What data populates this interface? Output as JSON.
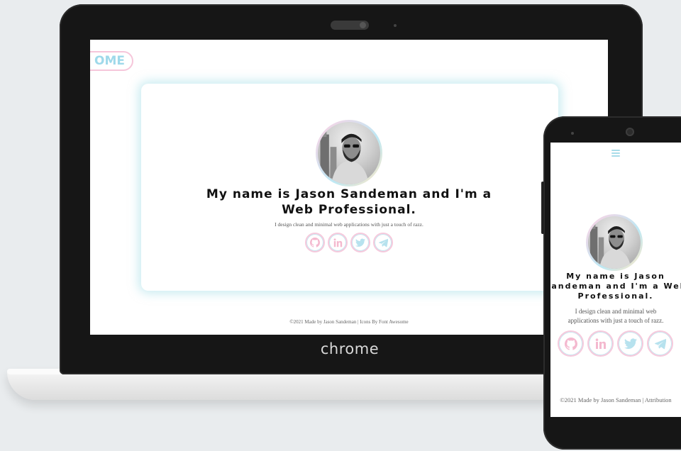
{
  "laptop": {
    "brand": "chrome",
    "site": {
      "logo_text": "OME",
      "headline": "My name is Jason Sandeman and I'm a Web Professional.",
      "tagline": "I design clean and minimal web applications with just a touch of razz.",
      "social_icons": [
        "github-icon",
        "linkedin-icon",
        "twitter-icon",
        "telegram-icon"
      ],
      "footer": "©2021 Made by Jason Sandeman | Icons By Font Awesome"
    }
  },
  "phone": {
    "site": {
      "menu_icon": "hamburger-icon",
      "headline_line1": "My name is Jason",
      "headline_line2": "Sandeman and I'm a Web",
      "headline_line3": "Professional.",
      "tagline_line1": "I design clean and minimal web",
      "tagline_line2": "applications with just a touch of razz.",
      "social_icons": [
        "github-icon",
        "linkedin-icon",
        "twitter-icon",
        "telegram-icon"
      ],
      "footer": "©2021 Made by Jason Sandeman | Attribution"
    }
  },
  "colors": {
    "background": "#e9ecee",
    "accent_pink": "#f6c9dc",
    "accent_cyan": "#a8dce9",
    "device_body": "#161616"
  }
}
